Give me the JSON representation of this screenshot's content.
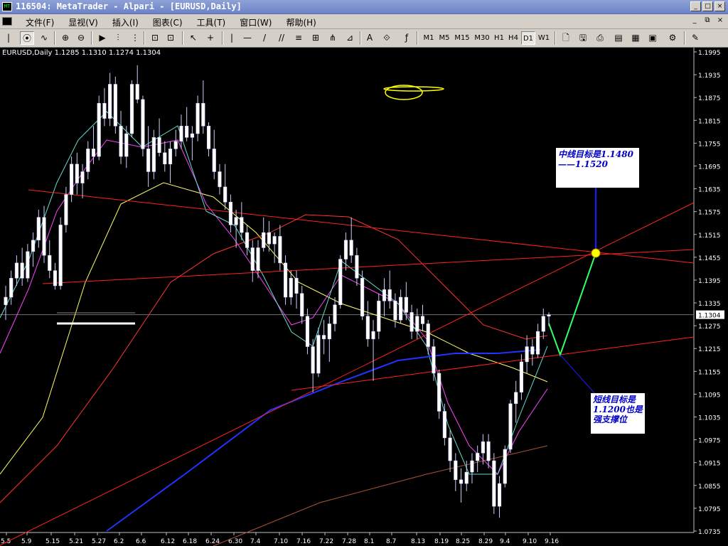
{
  "window": {
    "title": "116504: MetaTrader - Alpari - [EURUSD,Daily]",
    "buttons": [
      "_",
      "□",
      "×"
    ]
  },
  "menu": {
    "items": [
      "文件(F)",
      "显视(V)",
      "插入(I)",
      "图表(C)",
      "工具(T)",
      "窗口(W)",
      "帮助(H)"
    ],
    "mdi_buttons": [
      "_",
      "⧉",
      "×"
    ]
  },
  "toolbar": {
    "tools": [
      "|",
      "⊕",
      "⊖",
      "▶",
      "⫶",
      "⊡",
      "⊡",
      "↖",
      "+",
      "—",
      "/",
      "//",
      "≡",
      "⋔",
      "A",
      "⟐",
      "ƒ"
    ],
    "timeframes": [
      "M1",
      "M5",
      "M15",
      "M30",
      "H1",
      "H4",
      "D1",
      "W1"
    ],
    "active_timeframe": "D1"
  },
  "chart": {
    "symbol_label": "EURUSD,Daily",
    "ohlc_text": "1.1285 1.1310 1.1274 1.1304",
    "current_price": "1.1304",
    "annotations": {
      "mid_target": "中线目标是1.1480——1.1520",
      "short_target": "短线目标是1.1200也是强支撑位"
    }
  },
  "chart_data": {
    "type": "candlestick",
    "symbol": "EURUSD",
    "timeframe": "Daily",
    "ylim": [
      1.1735,
      1.1995
    ],
    "yticks": [
      "1.1995",
      "1.1935",
      "1.1875",
      "1.1815",
      "1.1755",
      "1.1695",
      "1.1635",
      "1.1575",
      "1.1515",
      "1.1455",
      "1.1395",
      "1.1335",
      "1.1275",
      "1.1215",
      "1.1155",
      "1.1095",
      "1.1035",
      "1.0975",
      "1.0915",
      "1.0855",
      "1.0795",
      "1.0735"
    ],
    "xticks": [
      "5.5",
      "5.9",
      "5.15",
      "5.21",
      "5.27",
      "6.2",
      "6.6",
      "6.12",
      "6.18",
      "6.24",
      "6.30",
      "7.4",
      "7.10",
      "7.16",
      "7.22",
      "7.28",
      "8.1",
      "8.7",
      "8.13",
      "8.19",
      "8.25",
      "8.29",
      "9.4",
      "9.10",
      "9.16"
    ],
    "candles": [
      [
        1.133,
        1.138,
        1.129,
        1.135
      ],
      [
        1.135,
        1.142,
        1.133,
        1.14
      ],
      [
        1.14,
        1.146,
        1.138,
        1.144
      ],
      [
        1.144,
        1.148,
        1.138,
        1.14
      ],
      [
        1.14,
        1.149,
        1.139,
        1.147
      ],
      [
        1.147,
        1.152,
        1.143,
        1.15
      ],
      [
        1.15,
        1.158,
        1.148,
        1.156
      ],
      [
        1.156,
        1.159,
        1.144,
        1.146
      ],
      [
        1.146,
        1.15,
        1.14,
        1.142
      ],
      [
        1.142,
        1.144,
        1.137,
        1.138
      ],
      [
        1.138,
        1.156,
        1.137,
        1.154
      ],
      [
        1.154,
        1.164,
        1.152,
        1.162
      ],
      [
        1.162,
        1.172,
        1.16,
        1.17
      ],
      [
        1.17,
        1.173,
        1.162,
        1.165
      ],
      [
        1.165,
        1.17,
        1.161,
        1.168
      ],
      [
        1.168,
        1.176,
        1.166,
        1.174
      ],
      [
        1.174,
        1.18,
        1.17,
        1.172
      ],
      [
        1.172,
        1.188,
        1.171,
        1.186
      ],
      [
        1.186,
        1.19,
        1.18,
        1.182
      ],
      [
        1.182,
        1.194,
        1.18,
        1.191
      ],
      [
        1.191,
        1.193,
        1.178,
        1.18
      ],
      [
        1.18,
        1.184,
        1.17,
        1.172
      ],
      [
        1.172,
        1.18,
        1.169,
        1.178
      ],
      [
        1.178,
        1.192,
        1.177,
        1.191
      ],
      [
        1.191,
        1.196,
        1.186,
        1.187
      ],
      [
        1.187,
        1.188,
        1.172,
        1.174
      ],
      [
        1.174,
        1.18,
        1.164,
        1.168
      ],
      [
        1.168,
        1.179,
        1.166,
        1.177
      ],
      [
        1.177,
        1.182,
        1.172,
        1.173
      ],
      [
        1.173,
        1.176,
        1.168,
        1.17
      ],
      [
        1.17,
        1.176,
        1.165,
        1.174
      ],
      [
        1.174,
        1.179,
        1.172,
        1.176
      ],
      [
        1.176,
        1.183,
        1.174,
        1.18
      ],
      [
        1.18,
        1.185,
        1.176,
        1.177
      ],
      [
        1.177,
        1.18,
        1.171,
        1.178
      ],
      [
        1.178,
        1.188,
        1.176,
        1.186
      ],
      [
        1.186,
        1.192,
        1.178,
        1.18
      ],
      [
        1.18,
        1.181,
        1.172,
        1.174
      ],
      [
        1.174,
        1.179,
        1.166,
        1.168
      ],
      [
        1.168,
        1.17,
        1.162,
        1.164
      ],
      [
        1.164,
        1.17,
        1.158,
        1.16
      ],
      [
        1.16,
        1.162,
        1.152,
        1.154
      ],
      [
        1.154,
        1.158,
        1.148,
        1.156
      ],
      [
        1.156,
        1.16,
        1.15,
        1.152
      ],
      [
        1.152,
        1.154,
        1.146,
        1.148
      ],
      [
        1.148,
        1.15,
        1.139,
        1.142
      ],
      [
        1.142,
        1.15,
        1.14,
        1.148
      ],
      [
        1.148,
        1.156,
        1.147,
        1.152
      ],
      [
        1.152,
        1.155,
        1.147,
        1.149
      ],
      [
        1.149,
        1.152,
        1.144,
        1.151
      ],
      [
        1.151,
        1.154,
        1.142,
        1.144
      ],
      [
        1.144,
        1.146,
        1.133,
        1.135
      ],
      [
        1.135,
        1.142,
        1.133,
        1.14
      ],
      [
        1.14,
        1.142,
        1.132,
        1.136
      ],
      [
        1.136,
        1.138,
        1.128,
        1.13
      ],
      [
        1.13,
        1.132,
        1.12,
        1.122
      ],
      [
        1.122,
        1.124,
        1.11,
        1.115
      ],
      [
        1.115,
        1.127,
        1.114,
        1.125
      ],
      [
        1.125,
        1.129,
        1.12,
        1.124
      ],
      [
        1.124,
        1.13,
        1.118,
        1.128
      ],
      [
        1.128,
        1.135,
        1.126,
        1.133
      ],
      [
        1.133,
        1.146,
        1.132,
        1.145
      ],
      [
        1.145,
        1.152,
        1.142,
        1.15
      ],
      [
        1.15,
        1.156,
        1.144,
        1.146
      ],
      [
        1.146,
        1.148,
        1.138,
        1.14
      ],
      [
        1.14,
        1.142,
        1.129,
        1.13
      ],
      [
        1.13,
        1.134,
        1.122,
        1.124
      ],
      [
        1.124,
        1.129,
        1.113,
        1.126
      ],
      [
        1.126,
        1.136,
        1.124,
        1.134
      ],
      [
        1.134,
        1.14,
        1.13,
        1.137
      ],
      [
        1.137,
        1.142,
        1.132,
        1.134
      ],
      [
        1.134,
        1.136,
        1.127,
        1.129
      ],
      [
        1.129,
        1.137,
        1.128,
        1.135
      ],
      [
        1.135,
        1.139,
        1.129,
        1.131
      ],
      [
        1.131,
        1.133,
        1.124,
        1.126
      ],
      [
        1.126,
        1.132,
        1.124,
        1.13
      ],
      [
        1.13,
        1.133,
        1.126,
        1.128
      ],
      [
        1.128,
        1.129,
        1.12,
        1.122
      ],
      [
        1.122,
        1.124,
        1.113,
        1.115
      ],
      [
        1.115,
        1.116,
        1.103,
        1.105
      ],
      [
        1.105,
        1.107,
        1.096,
        1.098
      ],
      [
        1.098,
        1.1,
        1.089,
        1.092
      ],
      [
        1.092,
        1.094,
        1.084,
        1.087
      ],
      [
        1.087,
        1.09,
        1.081,
        1.086
      ],
      [
        1.086,
        1.092,
        1.084,
        1.089
      ],
      [
        1.089,
        1.094,
        1.086,
        1.092
      ],
      [
        1.092,
        1.096,
        1.089,
        1.094
      ],
      [
        1.094,
        1.099,
        1.091,
        1.097
      ],
      [
        1.097,
        1.099,
        1.09,
        1.092
      ],
      [
        1.092,
        1.094,
        1.078,
        1.08
      ],
      [
        1.08,
        1.088,
        1.077,
        1.086
      ],
      [
        1.086,
        1.096,
        1.085,
        1.095
      ],
      [
        1.095,
        1.108,
        1.094,
        1.107
      ],
      [
        1.107,
        1.113,
        1.102,
        1.11
      ],
      [
        1.11,
        1.12,
        1.108,
        1.118
      ],
      [
        1.118,
        1.125,
        1.115,
        1.122
      ],
      [
        1.122,
        1.124,
        1.117,
        1.12
      ],
      [
        1.12,
        1.128,
        1.119,
        1.126
      ],
      [
        1.126,
        1.132,
        1.124,
        1.13
      ],
      [
        1.13,
        1.131,
        1.1274,
        1.1304
      ]
    ]
  }
}
